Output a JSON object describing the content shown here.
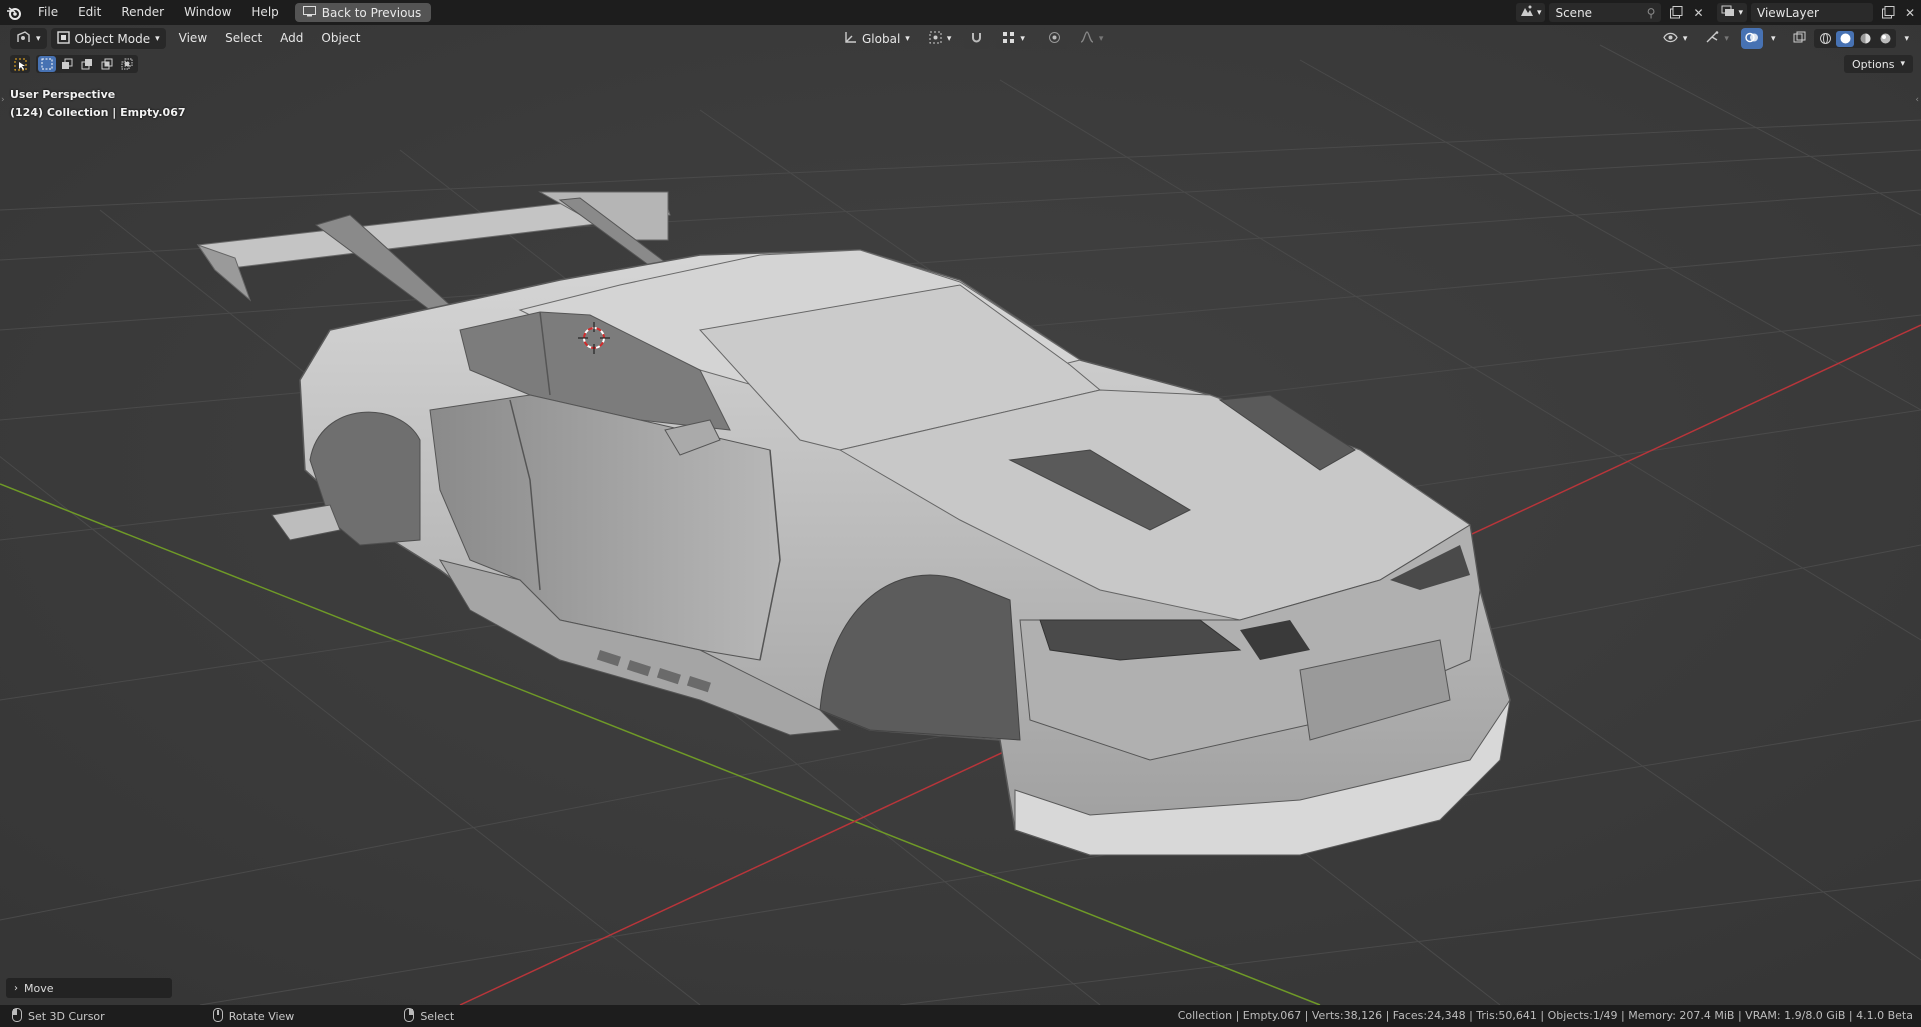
{
  "topbar": {
    "menus": [
      "File",
      "Edit",
      "Render",
      "Window",
      "Help"
    ],
    "back_button": "Back to Previous",
    "scene_name": "Scene",
    "view_layer_name": "ViewLayer"
  },
  "header": {
    "mode": "Object Mode",
    "menus": [
      "View",
      "Select",
      "Add",
      "Object"
    ],
    "transform_orientation": "Global",
    "options_label": "Options"
  },
  "viewport": {
    "perspective_label": "User Perspective",
    "collection_label": "(124) Collection | Empty.067"
  },
  "operator_panel": {
    "label": "Move"
  },
  "statusbar": {
    "left_action": "Set 3D Cursor",
    "middle_action": "Rotate View",
    "right_action": "Select",
    "stats": "Collection | Empty.067 | Verts:38,126 | Faces:24,348 | Tris:50,641 | Objects:1/49 | Memory: 207.4 MiB | VRAM: 1.9/8.0 GiB | 4.1.0 Beta"
  },
  "colors": {
    "accent": "#4772b3",
    "x_axis": "#b8353a",
    "y_axis": "#6f9a27",
    "background": "#3d3d3d"
  }
}
